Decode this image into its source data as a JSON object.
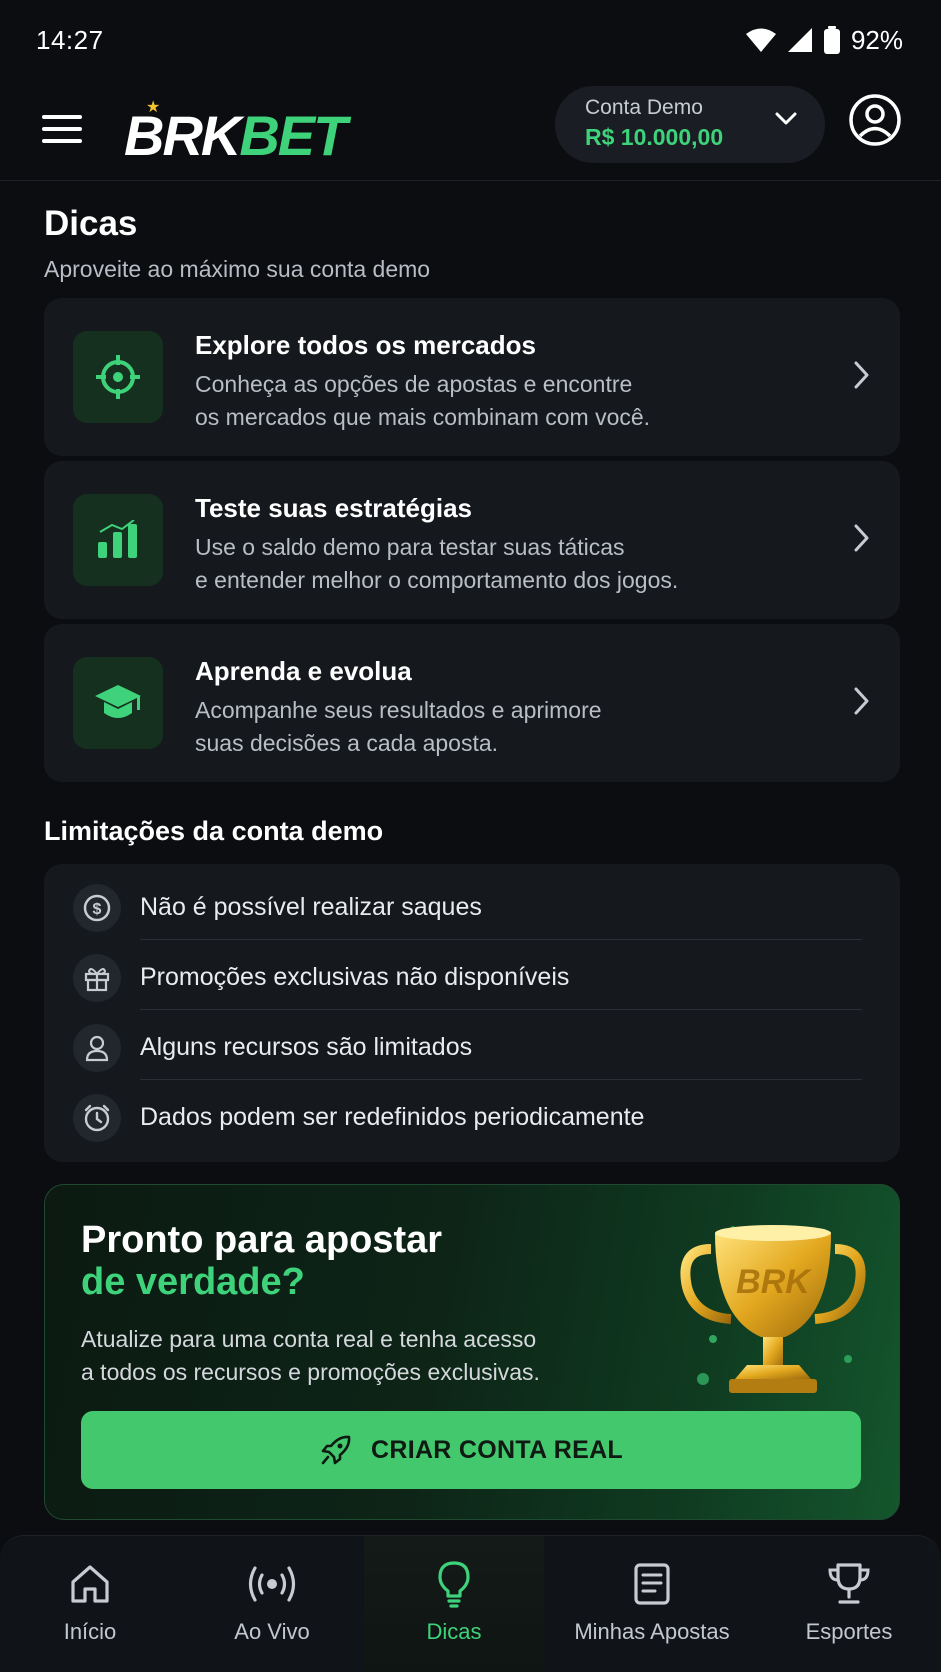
{
  "status": {
    "time": "14:27",
    "battery": "92%"
  },
  "header": {
    "logo_left": "BRK",
    "logo_right": "BET",
    "account_label": "Conta Demo",
    "account_balance": "R$ 10.000,00"
  },
  "tips": {
    "title": "Dicas",
    "subtitle": "Aproveite ao máximo sua conta demo",
    "items": [
      {
        "title": "Explore todos os mercados",
        "desc1": "Conheça as opções de apostas e encontre",
        "desc2": "os mercados que mais combinam com você.",
        "icon": "target-icon"
      },
      {
        "title": "Teste suas estratégias",
        "desc1": "Use o saldo demo para testar suas táticas",
        "desc2": "e entender melhor o comportamento dos jogos.",
        "icon": "bar-chart-icon"
      },
      {
        "title": "Aprenda e evolua",
        "desc1": "Acompanhe seus resultados e aprimore",
        "desc2": "suas decisões a cada aposta.",
        "icon": "graduation-cap-icon"
      }
    ]
  },
  "limits": {
    "title": "Limitações da conta demo",
    "items": [
      {
        "text": "Não é possível realizar saques",
        "icon": "money-icon"
      },
      {
        "text": "Promoções exclusivas não disponíveis",
        "icon": "gift-icon"
      },
      {
        "text": "Alguns recursos são limitados",
        "icon": "user-icon"
      },
      {
        "text": "Dados podem ser redefinidos periodicamente",
        "icon": "timer-icon"
      }
    ]
  },
  "promo": {
    "title_line1": "Pronto para apostar",
    "title_line2": "de verdade?",
    "desc1": "Atualize para uma conta real e tenha acesso",
    "desc2": "a todos os recursos e promoções exclusivas.",
    "trophy_text": "BRK",
    "button_label": "CRIAR CONTA REAL"
  },
  "nav": {
    "items": [
      {
        "label": "Início",
        "icon": "home-icon"
      },
      {
        "label": "Ao Vivo",
        "icon": "live-broadcast-icon"
      },
      {
        "label": "Dicas",
        "icon": "lightbulb-icon"
      },
      {
        "label": "Minhas Apostas",
        "icon": "bet-slip-icon"
      },
      {
        "label": "Esportes",
        "icon": "trophy-icon"
      }
    ],
    "active_index": 2
  },
  "colors": {
    "accent": "#3ed37a",
    "background": "#0b0d11",
    "card": "#15181d",
    "button": "#43c86e"
  }
}
